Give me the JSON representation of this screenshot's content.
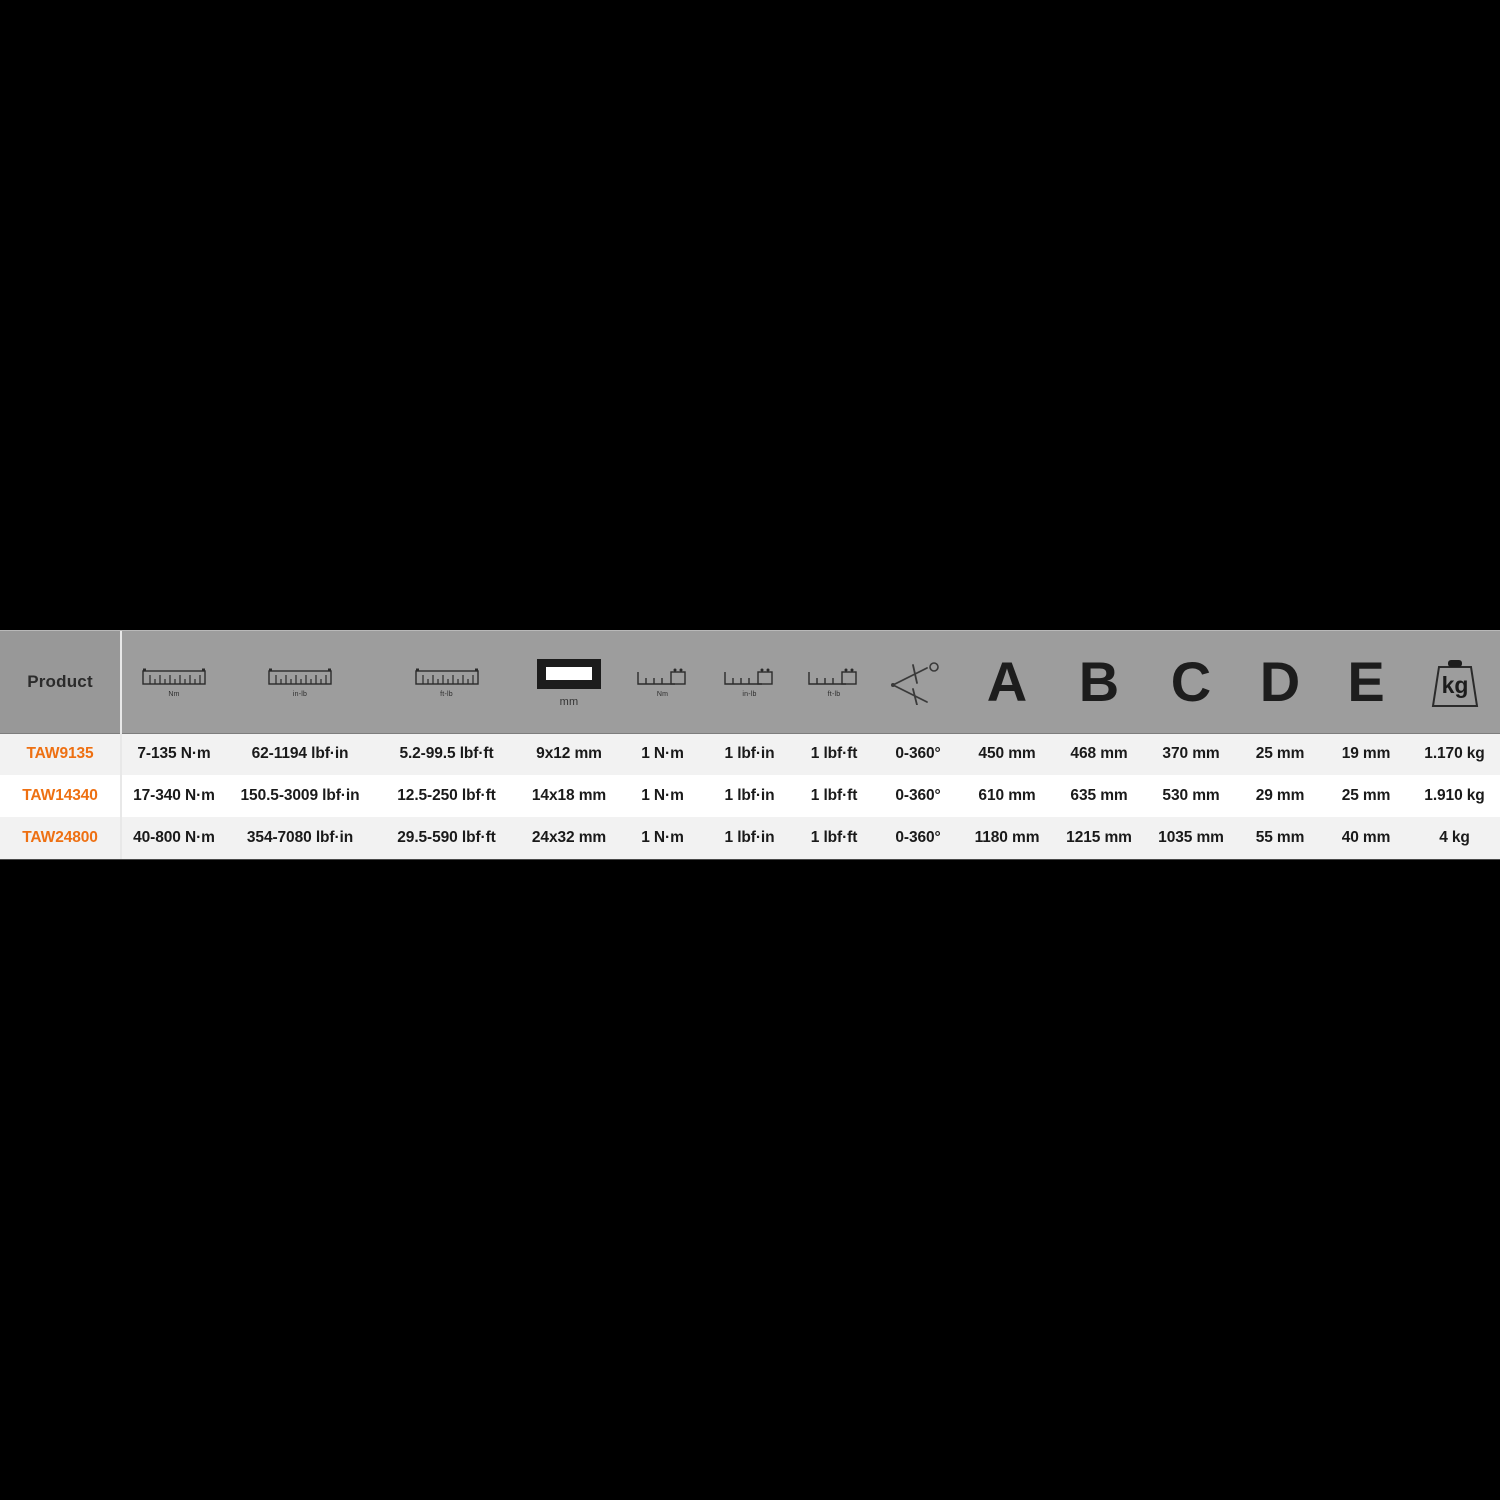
{
  "table": {
    "product_header_label": "Product",
    "columns": [
      {
        "key": "product",
        "type": "text",
        "label": "Product"
      },
      {
        "key": "range_nm",
        "type": "ruler",
        "icon": "ruler-icon",
        "sub": "Nm"
      },
      {
        "key": "range_inlb",
        "type": "ruler",
        "icon": "ruler-icon",
        "sub": "in-lb"
      },
      {
        "key": "range_ftlb",
        "type": "ruler",
        "icon": "ruler-icon",
        "sub": "ft-lb"
      },
      {
        "key": "square",
        "type": "rect",
        "icon": "rectangle-drive-icon",
        "sub": "mm"
      },
      {
        "key": "incr_nm",
        "type": "incr",
        "icon": "increment-icon",
        "sub": "Nm"
      },
      {
        "key": "incr_inlb",
        "type": "incr",
        "icon": "increment-icon",
        "sub": "in-lb"
      },
      {
        "key": "incr_ftlb",
        "type": "incr",
        "icon": "increment-icon",
        "sub": "ft-lb"
      },
      {
        "key": "angle",
        "type": "angle",
        "icon": "angle-degree-icon",
        "sub": ""
      },
      {
        "key": "dim_a",
        "type": "letter",
        "label": "A"
      },
      {
        "key": "dim_b",
        "type": "letter",
        "label": "B"
      },
      {
        "key": "dim_c",
        "type": "letter",
        "label": "C"
      },
      {
        "key": "dim_d",
        "type": "letter",
        "label": "D"
      },
      {
        "key": "dim_e",
        "type": "letter",
        "label": "E"
      },
      {
        "key": "weight",
        "type": "kg",
        "icon": "weight-kg-icon",
        "label": "kg"
      }
    ],
    "rows": [
      {
        "product": "TAW9135",
        "range_nm": "7-135 N·m",
        "range_inlb": "62-1194 lbf·in",
        "range_ftlb": "5.2-99.5 lbf·ft",
        "square": "9x12 mm",
        "incr_nm": "1 N·m",
        "incr_inlb": "1 lbf·in",
        "incr_ftlb": "1 lbf·ft",
        "angle": "0-360°",
        "dim_a": "450 mm",
        "dim_b": "468 mm",
        "dim_c": "370 mm",
        "dim_d": "25 mm",
        "dim_e": "19 mm",
        "weight": "1.170 kg"
      },
      {
        "product": "TAW14340",
        "range_nm": "17-340 N·m",
        "range_inlb": "150.5-3009 lbf·in",
        "range_ftlb": "12.5-250 lbf·ft",
        "square": "14x18 mm",
        "incr_nm": "1 N·m",
        "incr_inlb": "1 lbf·in",
        "incr_ftlb": "1 lbf·ft",
        "angle": "0-360°",
        "dim_a": "610 mm",
        "dim_b": "635 mm",
        "dim_c": "530 mm",
        "dim_d": "29 mm",
        "dim_e": "25 mm",
        "weight": "1.910 kg"
      },
      {
        "product": "TAW24800",
        "range_nm": "40-800 N·m",
        "range_inlb": "354-7080 lbf·in",
        "range_ftlb": "29.5-590 lbf·ft",
        "square": "24x32 mm",
        "incr_nm": "1 N·m",
        "incr_inlb": "1 lbf·in",
        "incr_ftlb": "1 lbf·ft",
        "angle": "0-360°",
        "dim_a": "1180 mm",
        "dim_b": "1215 mm",
        "dim_c": "1035 mm",
        "dim_d": "55 mm",
        "dim_e": "40 mm",
        "weight": "4 kg"
      }
    ]
  },
  "colors": {
    "header_bg": "#9d9d9d",
    "product_accent": "#ee7012",
    "row_odd": "#f2f2f2",
    "row_even": "#ffffff",
    "text": "#1a1a1a",
    "page_bg": "#000000"
  }
}
